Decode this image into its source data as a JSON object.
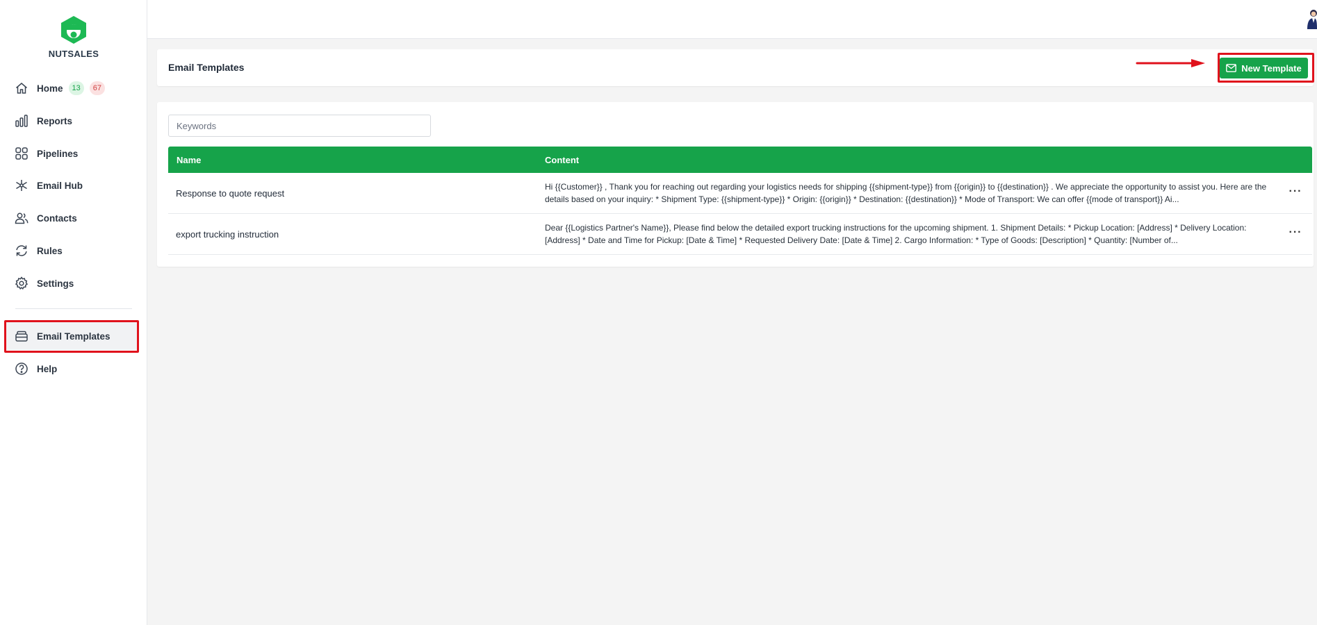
{
  "brand": {
    "name": "NUTSALES",
    "logo_icon": "nutsales-logo-icon",
    "color": "#1db954"
  },
  "sidebar": {
    "items": [
      {
        "label": "Home",
        "icon": "home-icon",
        "badges": [
          "13",
          "67"
        ]
      },
      {
        "label": "Reports",
        "icon": "bar-chart-icon"
      },
      {
        "label": "Pipelines",
        "icon": "grid-icon"
      },
      {
        "label": "Email Hub",
        "icon": "hub-icon"
      },
      {
        "label": "Contacts",
        "icon": "users-icon"
      },
      {
        "label": "Rules",
        "icon": "refresh-icon"
      },
      {
        "label": "Settings",
        "icon": "gear-icon"
      },
      {
        "label": "Email Templates",
        "icon": "inbox-icon",
        "active": true
      },
      {
        "label": "Help",
        "icon": "help-icon"
      }
    ]
  },
  "header": {
    "title": "Email Templates",
    "new_button_label": "New Template",
    "new_button_icon": "mail-icon"
  },
  "search": {
    "placeholder": "Keywords",
    "value": ""
  },
  "table": {
    "columns": [
      "Name",
      "Content"
    ],
    "rows": [
      {
        "name": "Response to quote request",
        "content": "Hi {{Customer}} ,   Thank you for reaching out regarding your logistics needs for shipping {{shipment-type}}   from {{origin}}  to {{destination}} . We appreciate the opportunity to assist you. Here are the details based on your inquiry: * Shipment Type: {{shipment-type}}  * Origin: {{origin}}  * Destination: {{destination}}  * Mode of Transport: We can offer {{mode of transport}} Ai..."
      },
      {
        "name": "export trucking instruction",
        "content": "Dear {{Logistics Partner's Name}}, Please find below the detailed export trucking instructions for the upcoming shipment. 1. Shipment Details: * Pickup Location: [Address] * Delivery Location: [Address] * Date and Time for Pickup: [Date & Time] * Requested Delivery Date: [Date & Time] 2. Cargo Information: * Type of Goods: [Description] * Quantity: [Number of..."
      }
    ],
    "row_action_label": "···"
  },
  "colors": {
    "accent": "#16a34a",
    "highlight": "#e0121c",
    "badge_green_bg": "#dcf5e4",
    "badge_red_bg": "#fbe1e1"
  }
}
